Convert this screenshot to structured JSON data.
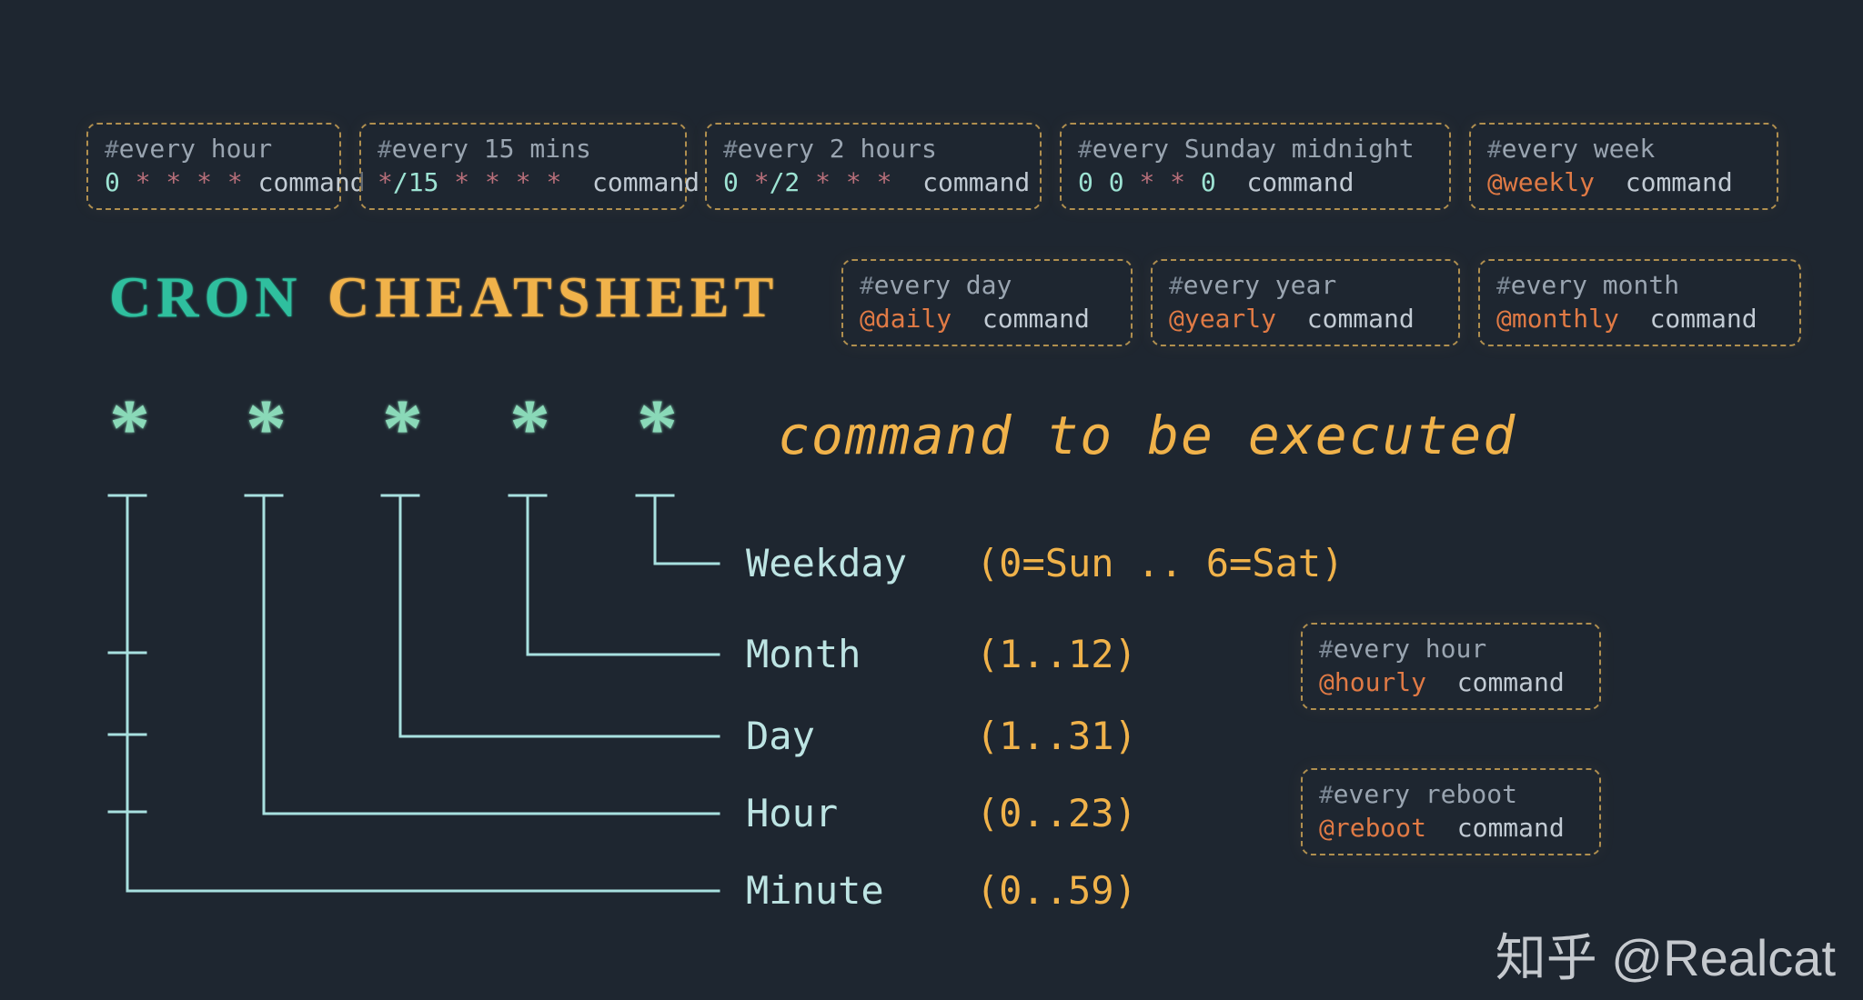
{
  "title": {
    "left": "CRON",
    "right": "CHEATSHEET"
  },
  "command_line_hint": "command to be executed",
  "fields": [
    {
      "name": "Weekday",
      "range": "(0=Sun .. 6=Sat)"
    },
    {
      "name": "Month",
      "range": "(1..12)"
    },
    {
      "name": "Day",
      "range": "(1..31)"
    },
    {
      "name": "Hour",
      "range": "(0..23)"
    },
    {
      "name": "Minute",
      "range": "(0..59)"
    }
  ],
  "cards_row1": [
    {
      "comment": "every hour",
      "expr_teal": "0 ",
      "expr_star": "* * * *",
      "suffix": " command"
    },
    {
      "comment": "every 15 mins",
      "expr_star_pre": "*",
      "expr_teal": "/15 ",
      "expr_star": "* * * *",
      "suffix": "  command"
    },
    {
      "comment": "every 2 hours",
      "expr_teal": "0 ",
      "expr_star_mid": "*",
      "expr_teal2": "/2 ",
      "expr_star": "* * *",
      "suffix": "  command"
    },
    {
      "comment": "every Sunday midnight",
      "expr_teal": "0 0 ",
      "expr_star": "* *",
      "expr_teal2": " 0",
      "suffix": "  command"
    },
    {
      "comment": "every week",
      "warm": "@weekly",
      "suffix": "  command"
    }
  ],
  "cards_row2": [
    {
      "comment": "every day",
      "warm": "@daily",
      "suffix": "  command"
    },
    {
      "comment": "every year",
      "warm": "@yearly",
      "suffix": "  command"
    },
    {
      "comment": "every month",
      "warm": "@monthly",
      "suffix": "  command"
    }
  ],
  "cards_side": [
    {
      "comment": "every hour",
      "warm": "@hourly",
      "suffix": "  command"
    },
    {
      "comment": "every reboot",
      "warm": "@reboot",
      "suffix": "  command"
    }
  ],
  "stars": [
    "*",
    "*",
    "*",
    "*",
    "*"
  ],
  "star_x": [
    140,
    290,
    440,
    580,
    720
  ],
  "watermark": "知乎 @Realcat",
  "colors": {
    "bg": "#1e2630",
    "teal": "#9de3d3",
    "orange": "#f0b24a",
    "warm": "#e07a45",
    "star": "#b86f7a",
    "line": "#a8e0df"
  }
}
